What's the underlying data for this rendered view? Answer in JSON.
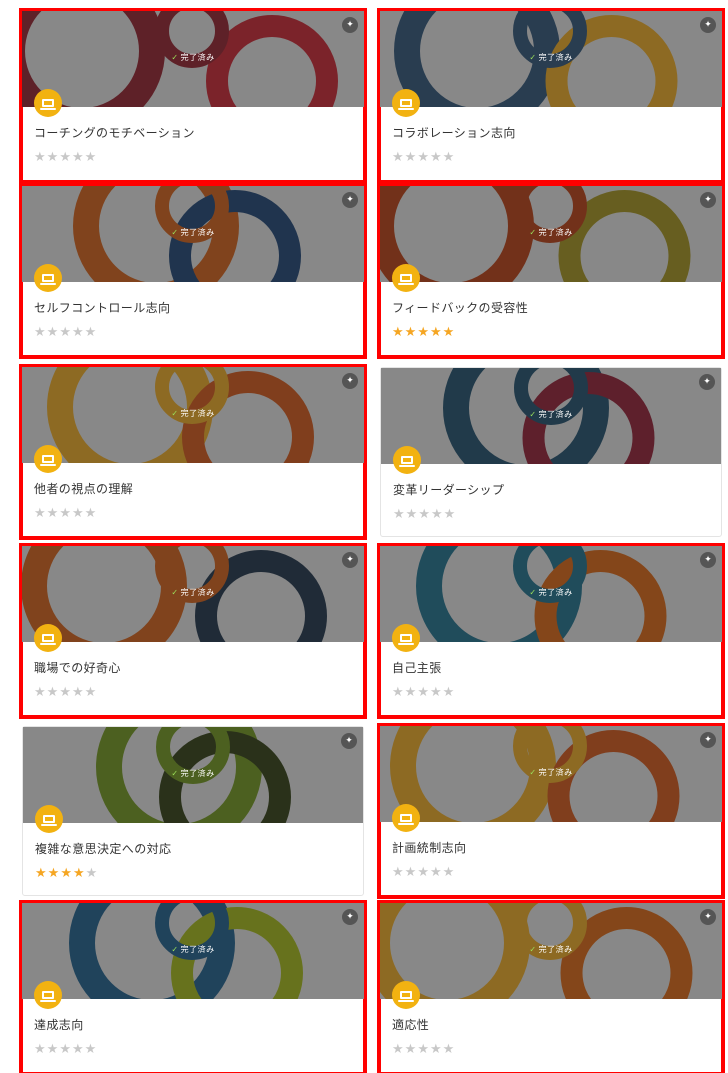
{
  "done_label": "完了済み",
  "cards": [
    {
      "title": "コーチングのモチベーション",
      "rating": 0,
      "highlighted": true,
      "pinned": true,
      "colors": [
        "#8b1d28",
        "#c0202d"
      ]
    },
    {
      "title": "コラボレーション志向",
      "rating": 0,
      "highlighted": true,
      "pinned": true,
      "colors": [
        "#2a4f72",
        "#e0a020"
      ]
    },
    {
      "title": "セルフコントロール志向",
      "rating": 0,
      "highlighted": true,
      "pinned": true,
      "colors": [
        "#c85a15",
        "#1a3f6e"
      ]
    },
    {
      "title": "フィードバックの受容性",
      "rating": 5,
      "highlighted": true,
      "pinned": true,
      "colors": [
        "#b03a10",
        "#9b8b1a"
      ]
    },
    {
      "title": "他者の視点の理解",
      "rating": 0,
      "highlighted": true,
      "pinned": true,
      "colors": [
        "#e0a020",
        "#c85015"
      ]
    },
    {
      "title": "変革リーダーシップ",
      "rating": 0,
      "highlighted": false,
      "pinned": true,
      "colors": [
        "#1d4a66",
        "#8a1a30"
      ]
    },
    {
      "title": "職場での好奇心",
      "rating": 0,
      "highlighted": true,
      "pinned": true,
      "colors": [
        "#c85a15",
        "#1b2f44"
      ]
    },
    {
      "title": "自己主張",
      "rating": 0,
      "highlighted": true,
      "pinned": true,
      "colors": [
        "#1a6a86",
        "#d06010"
      ]
    },
    {
      "title": "複雑な意思決定への対応",
      "rating": 4,
      "highlighted": false,
      "pinned": true,
      "colors": [
        "#6b8f1a",
        "#2c3a10"
      ]
    },
    {
      "title": "計画統制志向",
      "rating": 0,
      "highlighted": true,
      "pinned": true,
      "colors": [
        "#e0a020",
        "#c85015"
      ]
    },
    {
      "title": "達成志向",
      "rating": 0,
      "highlighted": true,
      "pinned": true,
      "colors": [
        "#1a5a86",
        "#9bb015"
      ]
    },
    {
      "title": "適応性",
      "rating": 0,
      "highlighted": true,
      "pinned": true,
      "colors": [
        "#e0a020",
        "#d06010"
      ]
    }
  ]
}
